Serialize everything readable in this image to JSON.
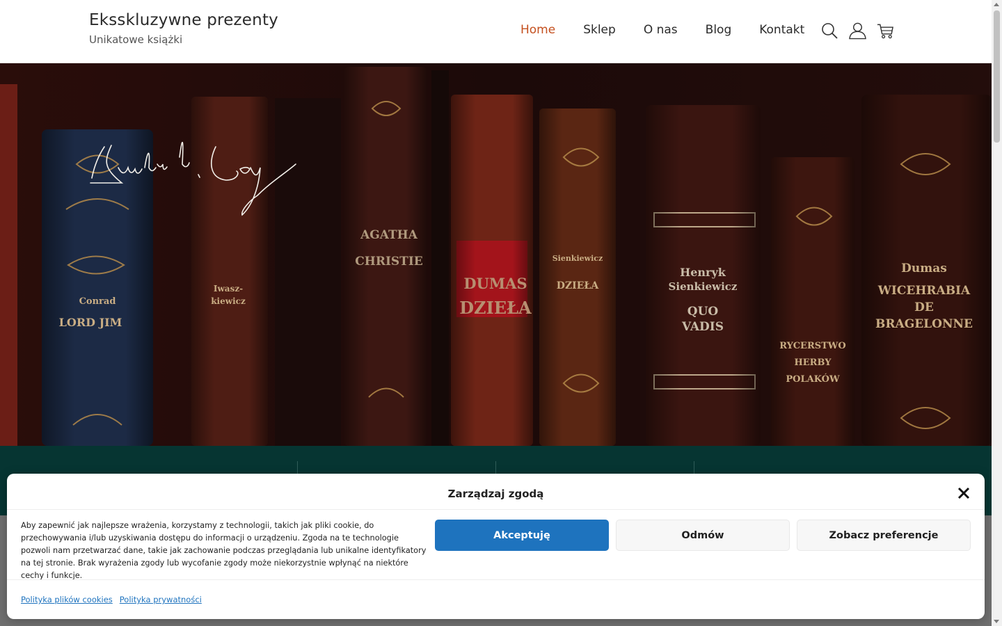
{
  "header": {
    "title": "Eksskluzywne prezenty",
    "tagline": "Unikatowe książki"
  },
  "nav": {
    "items": [
      {
        "label": "Home",
        "active": true
      },
      {
        "label": "Sklep"
      },
      {
        "label": "O nas"
      },
      {
        "label": "Blog"
      },
      {
        "label": "Kontakt"
      }
    ]
  },
  "icons": [
    "search-icon",
    "user-icon",
    "cart-icon"
  ],
  "hero": {
    "signature": "Kurtiak i Ley",
    "books": [
      {
        "lines": [
          "Conrad",
          "LORD JIM"
        ]
      },
      {
        "lines": [
          "Iwasz-",
          "kiewicz"
        ]
      },
      {
        "lines": [
          "AGATHA",
          "CHRISTIE"
        ]
      },
      {
        "lines": [
          "DUMAS",
          "DZIEŁA"
        ]
      },
      {
        "lines": [
          "Sienkiewicz",
          "DZIEŁA"
        ]
      },
      {
        "lines": [
          "Henryk",
          "Sienkiewicz",
          "QUO",
          "VADIS"
        ]
      },
      {
        "lines": [
          "RYCERSTWO",
          "HERBY",
          "POLAKÓW"
        ]
      },
      {
        "lines": [
          "Dumas",
          "WICEHRABIA",
          "DE",
          "BRAGELONNE"
        ]
      }
    ]
  },
  "cookie": {
    "title": "Zarządzaj zgodą",
    "text": "Aby zapewnić jak najlepsze wrażenia, korzystamy z technologii, takich jak pliki cookie, do przechowywania i/lub uzyskiwania dostępu do informacji o urządzeniu. Zgoda na te technologie pozwoli nam przetwarzać dane, takie jak zachowanie podczas przeglądania lub unikalne identyfikatory na tej stronie. Brak wyrażenia zgody lub wycofanie zgody może niekorzystnie wpłynąć na niektóre cechy i funkcje.",
    "accept": "Akceptuję",
    "deny": "Odmów",
    "preferences": "Zobacz preferencje",
    "links": [
      "Polityka plików cookies",
      "Polityka prywatności"
    ]
  },
  "colors": {
    "accent": "#c4501f",
    "band": "#063532",
    "button_primary": "#1e73be"
  }
}
